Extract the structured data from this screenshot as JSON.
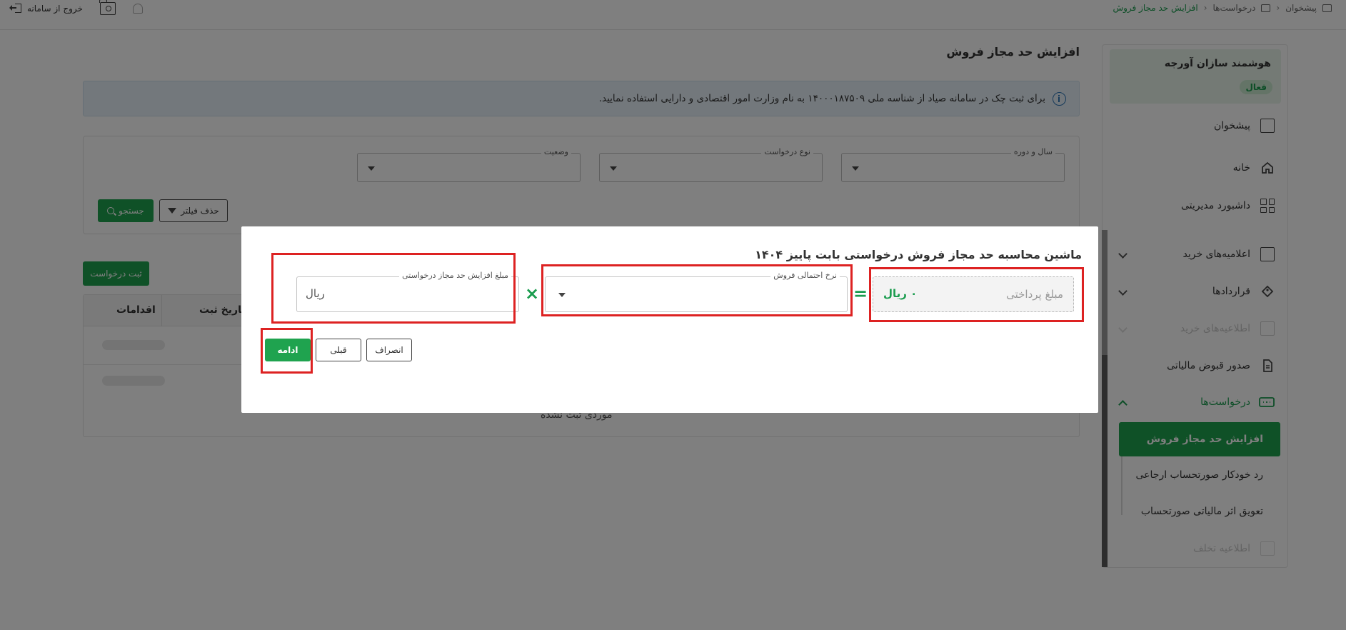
{
  "breadcrumb": {
    "items": [
      "پیشخوان",
      "درخواست‌ها",
      "افزایش حد مجاز فروش"
    ]
  },
  "topbar": {
    "logout_label": "خروج از سامانه"
  },
  "sidebar": {
    "company_name": "هوشمند سازان آورجه",
    "company_status": "فعال",
    "items": [
      {
        "label": "پیشخوان",
        "icon": "desk-icon"
      },
      {
        "label": "خانه",
        "icon": "home-icon"
      },
      {
        "label": "داشبورد مدیریتی",
        "icon": "dashboard-icon"
      },
      {
        "label": "اعلامیه‌های خرید",
        "icon": "receipt-icon"
      },
      {
        "label": "قراردادها",
        "icon": "contract-icon"
      },
      {
        "label": "اطلاعیه‌های خرید",
        "icon": "clipboard-icon"
      },
      {
        "label": "صدور قبوض مالیاتی",
        "icon": "document-icon"
      },
      {
        "label": "درخواست‌ها",
        "icon": "ticket-icon"
      }
    ],
    "sub_items": [
      "افزایش حد مجاز فروش",
      "رد خودکار صورتحساب ارجاعی",
      "تعویق اثر مالیاتی صورتحساب"
    ],
    "last_item": "اطلاعیه تخلف"
  },
  "main": {
    "title": "افزایش حد مجاز فروش",
    "info_text": "برای ثبت چک در سامانه صیاد از شناسه ملی ۱۴۰۰۰۱۸۷۵۰۹ به نام وزارت امور اقتصادی و دارایی استفاده نمایید.",
    "filters": {
      "year_label": "سال و دوره",
      "type_label": "نوع درخواست",
      "status_label": "وضعیت",
      "clear_label": "حذف فیلتر",
      "search_label": "جستجو"
    },
    "new_request_label": "ثبت درخواست",
    "table": {
      "columns": [
        "اقدامات",
        "تاریخ ثبت"
      ],
      "empty_text": "موردی ثبت نشده"
    }
  },
  "modal": {
    "title": "ماشین محاسبه حد مجاز فروش درخواستی بابت پاییز ۱۴۰۴",
    "payment_label": "مبلغ پرداختی",
    "payment_value": "۰ ریال",
    "equals_symbol": "=",
    "times_symbol": "×",
    "rate_label": "نرخ احتمالی فروش",
    "rate_value": "",
    "amount_label": "مبلغ افزایش حد مجاز درخواستی",
    "amount_suffix": "ریال",
    "buttons": {
      "cancel": "انصراف",
      "back": "قبلی",
      "continue": "ادامه"
    }
  },
  "colors": {
    "brand_green": "#1fa34f",
    "highlight_red": "#dd2222",
    "info_blue": "#2f76b6"
  }
}
